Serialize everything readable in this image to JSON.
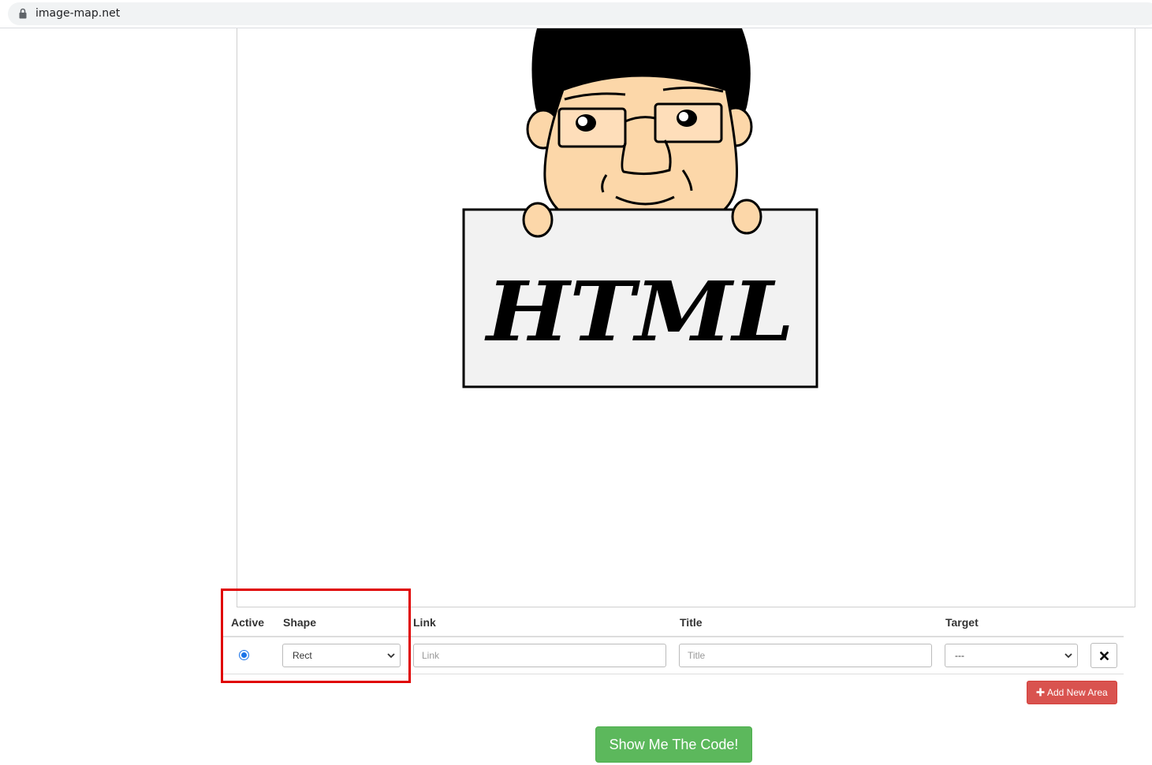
{
  "browser": {
    "url": "image-map.net"
  },
  "image": {
    "sign_text": "HTML"
  },
  "table": {
    "headers": {
      "active": "Active",
      "shape": "Shape",
      "link": "Link",
      "title": "Title",
      "target": "Target"
    },
    "row": {
      "shape_value": "Rect",
      "link_placeholder": "Link",
      "title_placeholder": "Title",
      "target_value": "---"
    }
  },
  "buttons": {
    "add_area": "Add New Area",
    "show_code": "Show Me The Code!"
  },
  "colors": {
    "add_button": "#d9534f",
    "code_button": "#5cb85c",
    "highlight": "#e00000"
  },
  "icons": {
    "lock": "lock-icon",
    "chevron": "chevron-down-icon",
    "close": "close-icon",
    "plus": "plus-icon"
  }
}
